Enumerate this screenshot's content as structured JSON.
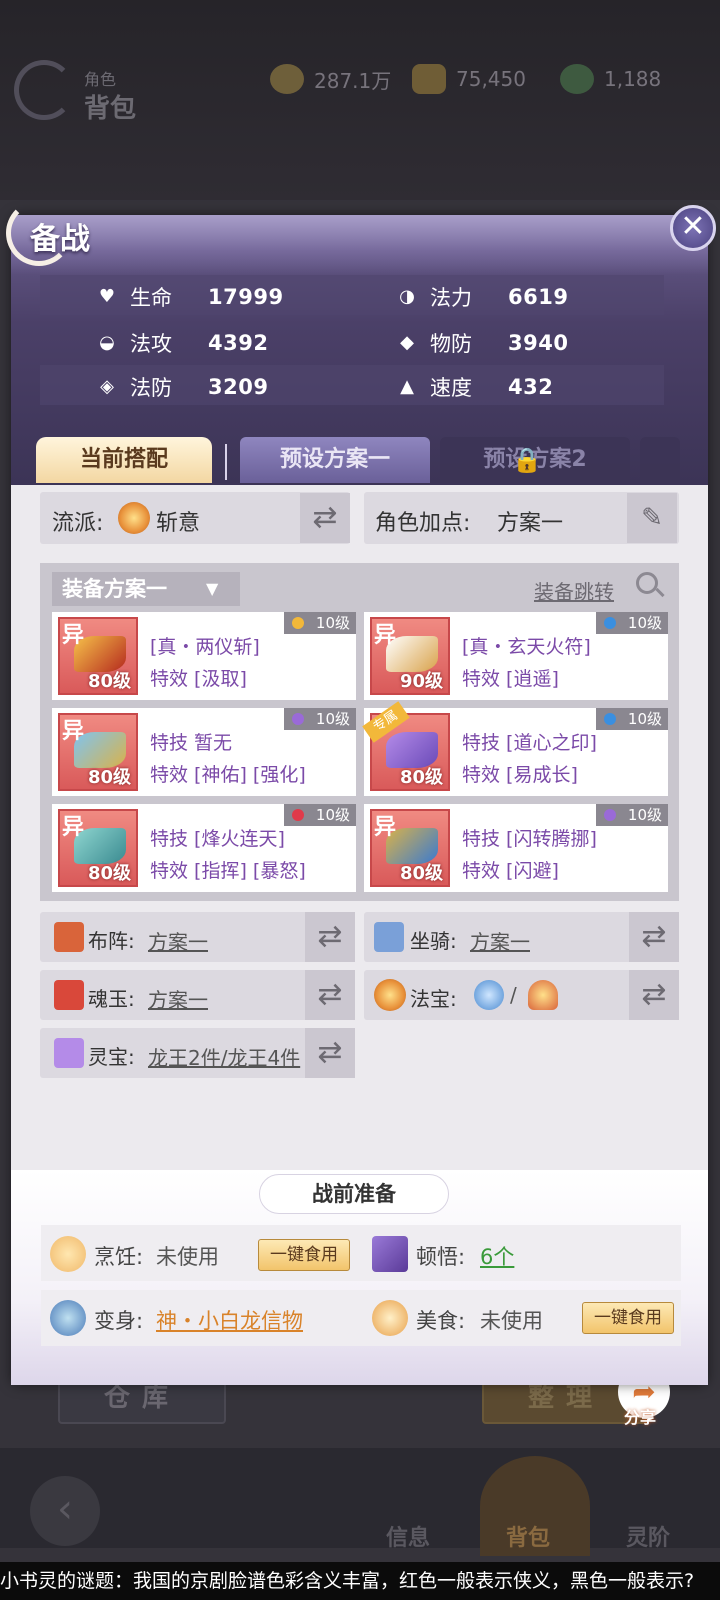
{
  "top": {
    "title_small": "角色",
    "title": "背包",
    "resources": [
      {
        "name": "coin-icon",
        "value": "287.1万"
      },
      {
        "name": "ingot-icon",
        "value": "75,450"
      },
      {
        "name": "jade-icon",
        "value": "1,188"
      }
    ]
  },
  "panel": {
    "title": "备战",
    "close_label": "✕",
    "stats": [
      {
        "label": "生命",
        "value": "17999",
        "icon": "heart-icon"
      },
      {
        "label": "法力",
        "value": "6619",
        "icon": "swirl-icon"
      },
      {
        "label": "法攻",
        "value": "4392",
        "icon": "wave-icon"
      },
      {
        "label": "物防",
        "value": "3940",
        "icon": "armor-icon"
      },
      {
        "label": "法防",
        "value": "3209",
        "icon": "shield-icon"
      },
      {
        "label": "速度",
        "value": "432",
        "icon": "boot-icon"
      }
    ],
    "tabs": [
      {
        "label": "当前搭配"
      },
      {
        "label": "预设方案一"
      },
      {
        "label": "预设方案2"
      }
    ],
    "school": {
      "label": "流派:",
      "value": "斩意"
    },
    "attr_points": {
      "label": "角色加点:",
      "value": "方案一"
    },
    "equip_plan": {
      "label": "装备方案一",
      "jump": "装备跳转"
    },
    "equipment": [
      {
        "tag": "异",
        "level": "80级",
        "badge": "10级",
        "line1": "[真・两仪斩]",
        "line2": "特效 [汲取]"
      },
      {
        "tag": "异",
        "level": "90级",
        "badge": "10级",
        "line1": "[真・玄天火符]",
        "line2": "特效 [逍遥]"
      },
      {
        "tag": "异",
        "level": "80级",
        "badge": "10级",
        "line1": "特技  暂无",
        "line2": "特效 [神佑] [强化]"
      },
      {
        "tag": "专属",
        "level": "80级",
        "badge": "10级",
        "line1": "特技 [道心之印]",
        "line2": "特效 [易成长]"
      },
      {
        "tag": "异",
        "level": "80级",
        "badge": "10级",
        "line1": "特技 [烽火连天]",
        "line2": "特效 [指挥] [暴怒]"
      },
      {
        "tag": "异",
        "level": "80级",
        "badge": "10级",
        "line1": "特技 [闪转腾挪]",
        "line2": "特效 [闪避]"
      }
    ],
    "formation": {
      "label": "布阵:",
      "value": "方案一"
    },
    "mount": {
      "label": "坐骑:",
      "value": "方案一"
    },
    "soul_jade": {
      "label": "魂玉:",
      "value": "方案一"
    },
    "magic_treasure": {
      "label": "法宝:",
      "separator": "/"
    },
    "spirit_treasure": {
      "label": "灵宝:",
      "value": "龙王2件/龙王4件"
    },
    "prep": {
      "title": "战前准备",
      "cooking": {
        "label": "烹饪:",
        "value": "未使用",
        "button": "一键食用"
      },
      "insight": {
        "label": "顿悟:",
        "value": "6个"
      },
      "transform": {
        "label": "变身:",
        "value": "神・小白龙信物"
      },
      "food": {
        "label": "美食:",
        "value": "未使用",
        "button": "一键食用"
      }
    }
  },
  "bottom": {
    "storage": "仓库",
    "sort": "整理",
    "share": "分享",
    "nav": [
      "信息",
      "背包",
      "灵阶"
    ]
  },
  "ticker": "小书灵的谜题：我国的京剧脸谱色彩含义丰富，红色一般表示侠义，黑色一般表示?"
}
